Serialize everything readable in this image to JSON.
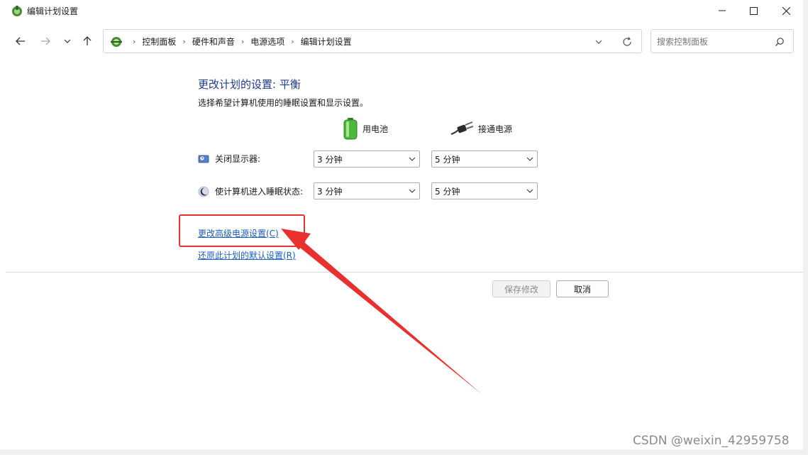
{
  "window": {
    "title": "编辑计划设置"
  },
  "address_bar": {
    "crumbs": [
      "控制面板",
      "硬件和声音",
      "电源选项",
      "编辑计划设置"
    ]
  },
  "search": {
    "placeholder": "搜索控制面板"
  },
  "content": {
    "heading": "更改计划的设置: 平衡",
    "subheading": "选择希望计算机使用的睡眠设置和显示设置。",
    "columns": {
      "battery": "用电池",
      "plugged": "接通电源"
    },
    "rows": [
      {
        "label": "关闭显示器:",
        "battery": "3 分钟",
        "plugged": "5 分钟"
      },
      {
        "label": "使计算机进入睡眠状态:",
        "battery": "3 分钟",
        "plugged": "5 分钟"
      }
    ],
    "links": {
      "advanced": "更改高级电源设置(C)",
      "restore": "还原此计划的默认设置(R)"
    }
  },
  "buttons": {
    "save": "保存修改",
    "cancel": "取消"
  },
  "annotation": {
    "color": "#e8312f"
  },
  "watermark": "CSDN @weixin_42959758"
}
